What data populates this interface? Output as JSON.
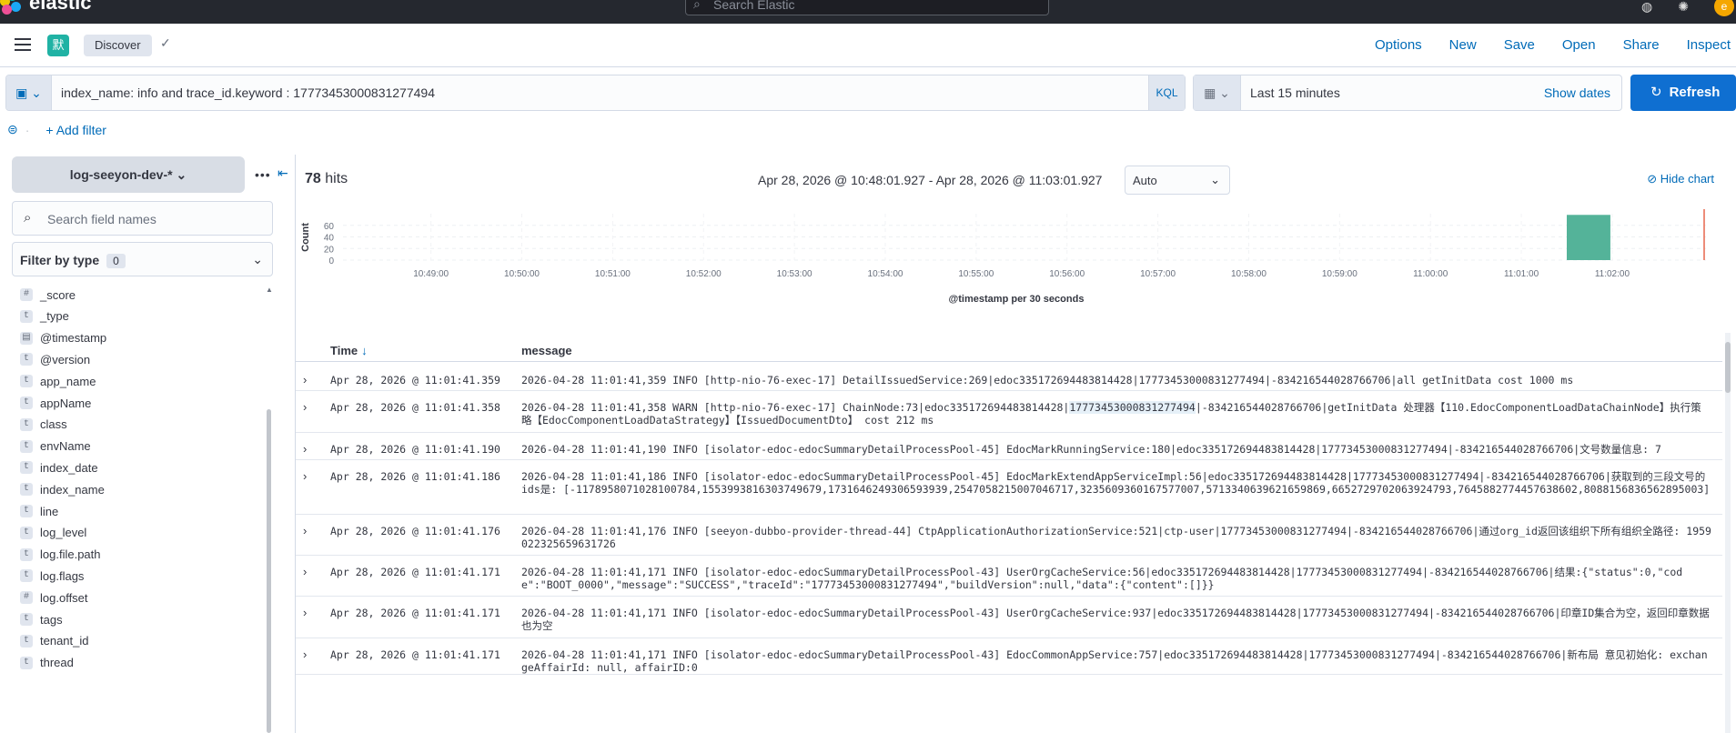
{
  "topbar": {
    "logo_text": "elastic",
    "search_placeholder": "Search Elastic",
    "avatar_letter": "e",
    "colors": {
      "bg": "#25282f"
    }
  },
  "nav": {
    "app_icon": "默",
    "breadcrumb": "Discover",
    "menu": [
      "Options",
      "New",
      "Save",
      "Open",
      "Share",
      "Inspect"
    ]
  },
  "query": {
    "text": "index_name: info and trace_id.keyword : 17773453000831277494",
    "language": "KQL"
  },
  "time": {
    "quick": "Last 15 minutes",
    "show_dates": "Show dates",
    "refresh": "Refresh"
  },
  "filters": {
    "add_label": "+ Add filter"
  },
  "sidebar": {
    "index_pattern": "log-seeyon-dev-*",
    "search_placeholder": "Search field names",
    "filter_by_type": "Filter by type",
    "filter_count": "0",
    "fields": [
      {
        "type": "#",
        "name": "_score"
      },
      {
        "type": "t",
        "name": "_type"
      },
      {
        "type": "d",
        "name": "@timestamp"
      },
      {
        "type": "t",
        "name": "@version"
      },
      {
        "type": "t",
        "name": "app_name"
      },
      {
        "type": "t",
        "name": "appName"
      },
      {
        "type": "t",
        "name": "class"
      },
      {
        "type": "t",
        "name": "envName"
      },
      {
        "type": "t",
        "name": "index_date"
      },
      {
        "type": "t",
        "name": "index_name"
      },
      {
        "type": "t",
        "name": "line"
      },
      {
        "type": "t",
        "name": "log_level"
      },
      {
        "type": "t",
        "name": "log.file.path"
      },
      {
        "type": "t",
        "name": "log.flags"
      },
      {
        "type": "#",
        "name": "log.offset"
      },
      {
        "type": "t",
        "name": "tags"
      },
      {
        "type": "t",
        "name": "tenant_id"
      },
      {
        "type": "t",
        "name": "thread"
      }
    ]
  },
  "main": {
    "hits_count": "78",
    "hits_label": "hits",
    "range": "Apr 28, 2026 @ 10:48:01.927 - Apr 28, 2026 @ 11:03:01.927",
    "interval": "Auto",
    "hide_chart": "Hide chart",
    "columns": {
      "time": "Time",
      "message": "message"
    }
  },
  "chart_data": {
    "type": "bar",
    "ylabel": "Count",
    "xlabel": "@timestamp per 30 seconds",
    "ylim": [
      0,
      80
    ],
    "yticks": [
      0,
      20,
      40,
      60
    ],
    "xticks": [
      "10:49:00",
      "10:50:00",
      "10:51:00",
      "10:52:00",
      "10:53:00",
      "10:54:00",
      "10:55:00",
      "10:56:00",
      "10:57:00",
      "10:58:00",
      "10:59:00",
      "11:00:00",
      "11:01:00",
      "11:02:00"
    ],
    "bars": [
      {
        "x": "11:01:30",
        "value": 78
      }
    ],
    "bar_color": "#54b399",
    "now_marker": "11:03:01.927",
    "grid": true
  },
  "rows": [
    {
      "time": "Apr 28, 2026 @ 11:01:41.359",
      "msg": "2026-04-28 11:01:41,359 INFO  [http-nio-76-exec-17] DetailIssuedService:269|edoc335172694483814428|17773453000831277494|-834216544028766706|all getInitData cost 1000 ms"
    },
    {
      "time": "Apr 28, 2026 @ 11:01:41.358",
      "msg_a": "2026-04-28 11:01:41,358 WARN  [http-nio-76-exec-17] ChainNode:73|edoc335172694483814428|",
      "msg_hl": "17773453000831277494",
      "msg_b": "|-834216544028766706|getInitData 处理器【110.EdocComponentLoadDataChainNode】执行策略【EdocComponentLoadDataStrategy】【IssuedDocumentDto】 cost 212 ms"
    },
    {
      "time": "Apr 28, 2026 @ 11:01:41.190",
      "msg": "2026-04-28 11:01:41,190 INFO  [isolator-edoc-edocSummaryDetailProcessPool-45] EdocMarkRunningService:180|edoc335172694483814428|17773453000831277494|-834216544028766706|文号数量信息: 7"
    },
    {
      "time": "Apr 28, 2026 @ 11:01:41.186",
      "msg": "2026-04-28 11:01:41,186 INFO  [isolator-edoc-edocSummaryDetailProcessPool-45] EdocMarkExtendAppServiceImpl:56|edoc335172694483814428|17773453000831277494|-834216544028766706|获取到的三段文号的ids是: [-1178958071028100784,1553993816303749679,1731646249306593939,2547058215007046717,3235609360167577007,5713340639621659869,6652729702063924793,7645882774457638602,8088156836562895003]"
    },
    {
      "time": "Apr 28, 2026 @ 11:01:41.176",
      "msg": "2026-04-28 11:01:41,176 INFO  [seeyon-dubbo-provider-thread-44] CtpApplicationAuthorizationService:521|ctp-user|17773453000831277494|-834216544028766706|通过org_id返回该组织下所有组织全路径: 1959022325659631726"
    },
    {
      "time": "Apr 28, 2026 @ 11:01:41.171",
      "msg": "2026-04-28 11:01:41,171 INFO  [isolator-edoc-edocSummaryDetailProcessPool-43] UserOrgCacheService:56|edoc335172694483814428|17773453000831277494|-834216544028766706|结果:{\"status\":0,\"code\":\"BOOT_0000\",\"message\":\"SUCCESS\",\"traceId\":\"17773453000831277494\",\"buildVersion\":null,\"data\":{\"content\":[]}}"
    },
    {
      "time": "Apr 28, 2026 @ 11:01:41.171",
      "msg": "2026-04-28 11:01:41,171 INFO  [isolator-edoc-edocSummaryDetailProcessPool-43] UserOrgCacheService:937|edoc335172694483814428|17773453000831277494|-834216544028766706|印章ID集合为空，返回印章数据也为空"
    },
    {
      "time": "Apr 28, 2026 @ 11:01:41.171",
      "msg": "2026-04-28 11:01:41,171 INFO  [isolator-edoc-edocSummaryDetailProcessPool-43] EdocCommonAppService:757|edoc335172694483814428|17773453000831277494|-834216544028766706|新布局 意见初始化: exchangeAffairId: null, affairID:0"
    }
  ]
}
